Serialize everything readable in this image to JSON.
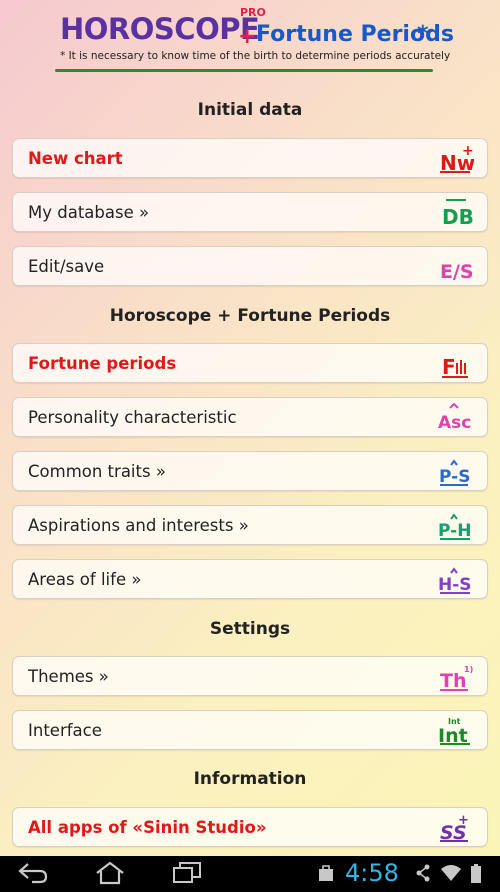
{
  "header": {
    "title_main": "HOROSCOPE",
    "title_pro": "PRO",
    "title_plus": "+",
    "title_sub": "Fortune Periods",
    "title_star": "*",
    "note": "* It is necessary to know time of the birth to determine periods accurately"
  },
  "sections": {
    "initial": "Initial data",
    "horoscope": "Horoscope + Fortune Periods",
    "settings": "Settings",
    "information": "Information"
  },
  "items": {
    "new_chart": {
      "label": "New chart",
      "icon": "Nw"
    },
    "my_database": {
      "label": "My database »",
      "icon": "DB"
    },
    "edit_save": {
      "label": "Edit/save",
      "icon": "E/S"
    },
    "fortune_periods": {
      "label": "Fortune periods",
      "icon": "F"
    },
    "personality": {
      "label": "Personality characteristic",
      "icon": "Asc"
    },
    "common_traits": {
      "label": "Common traits »",
      "icon": "P-S"
    },
    "aspirations": {
      "label": "Aspirations and interests »",
      "icon": "P-H"
    },
    "areas_of_life": {
      "label": "Areas of life »",
      "icon": "H-S"
    },
    "themes": {
      "label": "Themes »",
      "icon": "Th"
    },
    "interface": {
      "label": "Interface",
      "icon": "Int"
    },
    "all_apps": {
      "label": "All apps of «Sinin Studio»",
      "icon": "SS"
    }
  },
  "statusbar": {
    "time": "4:58"
  },
  "colors": {
    "accent_red": "#e01818",
    "title_purple": "#5a32a0",
    "title_blue": "#1858c8",
    "divider_green": "#2a8c30",
    "clock_blue": "#33b5e5"
  }
}
